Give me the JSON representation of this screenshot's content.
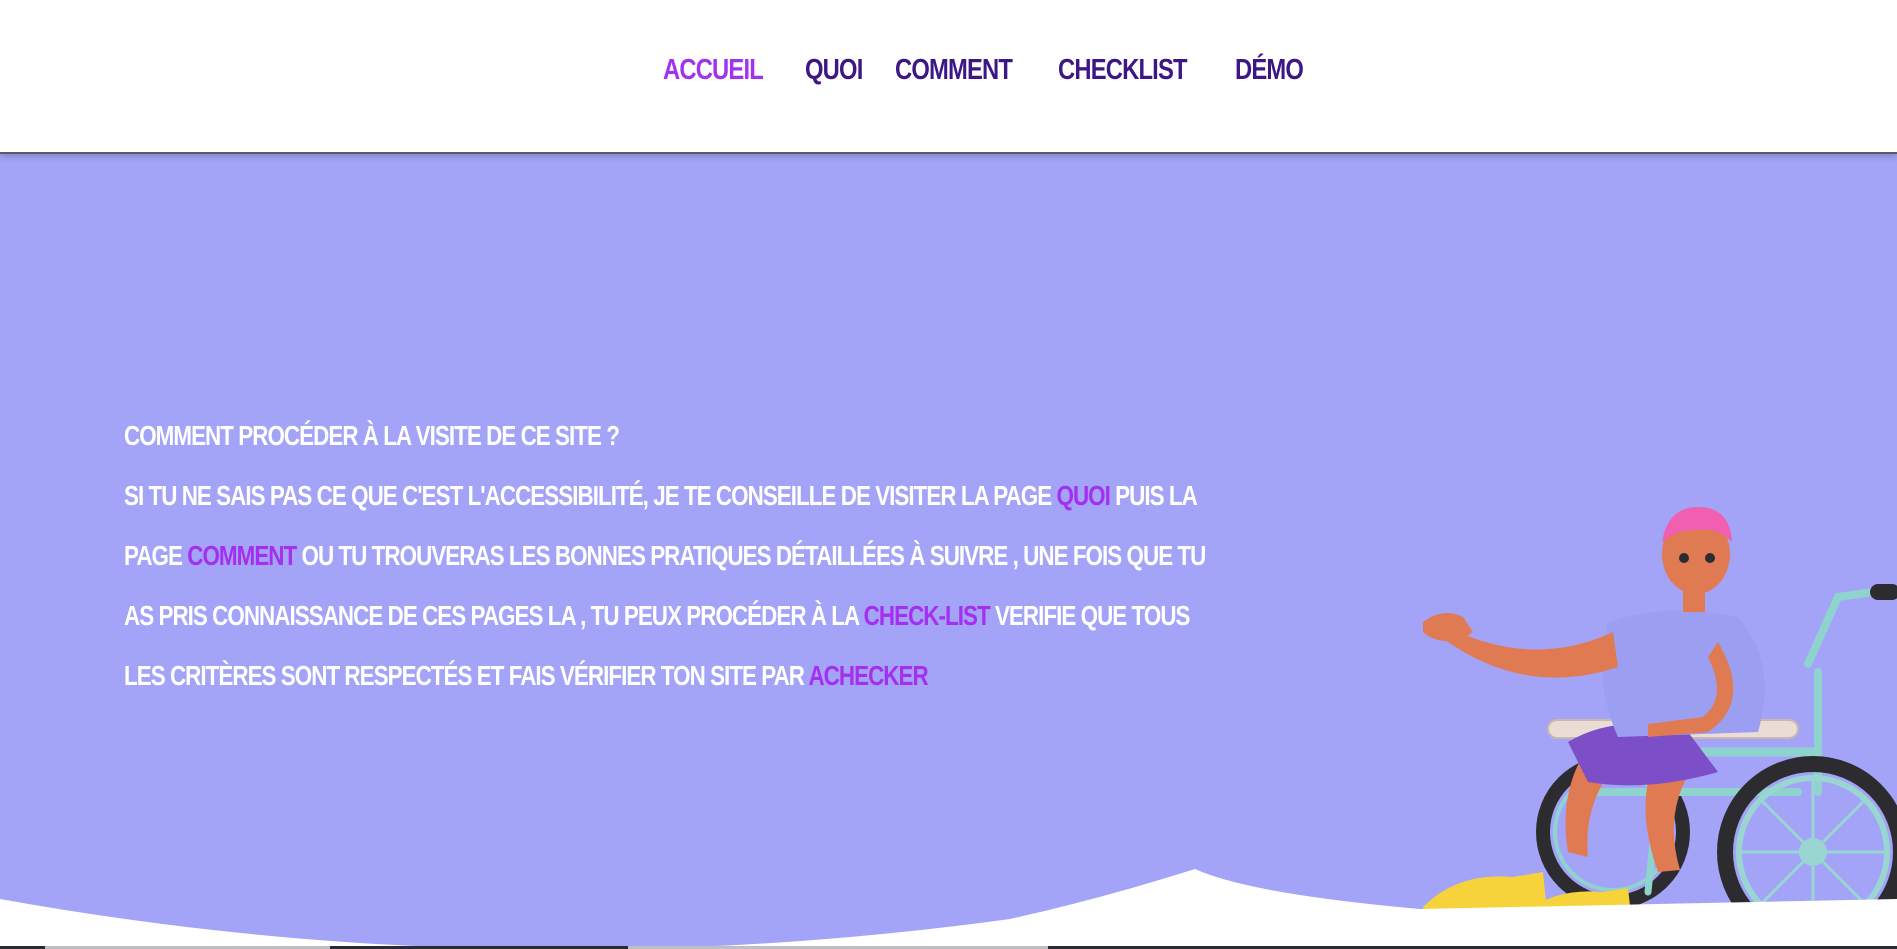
{
  "nav": {
    "items": [
      {
        "label": "ACCUEIL",
        "active": true
      },
      {
        "label": "QUOI",
        "active": false
      },
      {
        "label": "COMMENT",
        "active": false
      },
      {
        "label": "CHECKLIST",
        "active": false
      },
      {
        "label": "DÉMO",
        "active": false
      }
    ]
  },
  "intro": {
    "title": "COMMENT PROCÉDER À LA VISITE DE CE SITE ?",
    "l1_pre": "SI TU NE SAIS PAS CE QUE C'EST L'ACCESSIBILITÉ, JE TE CONSEILLE DE VISITER LA PAGE ",
    "l1_link": "QUOI",
    "l1_post": " PUIS LA",
    "l2_pre": "PAGE ",
    "l2_link": "COMMENT",
    "l2_post": " OU TU TROUVERAS LES BONNES PRATIQUES DÉTAILLÉES À SUIVRE , UNE FOIS QUE TU",
    "l3_pre": "AS PRIS CONNAISSANCE DE CES PAGES LA , TU PEUX PROCÉDER À LA ",
    "l3_link": "CHECK-LIST",
    "l3_post": " VERIFIE QUE TOUS",
    "l4_pre": "LES CRITÈRES SONT RESPECTÉS ET FAIS VÉRIFIER TON SITE PAR ",
    "l4_link": "ACHECKER"
  },
  "colors": {
    "hero_bg": "#a3a4f8",
    "nav_text": "#3d1786",
    "nav_active": "#a033ee",
    "link": "#a52ff0",
    "text": "#ffffff"
  },
  "illustration": {
    "icon": "wheelchair-user-illustration"
  }
}
